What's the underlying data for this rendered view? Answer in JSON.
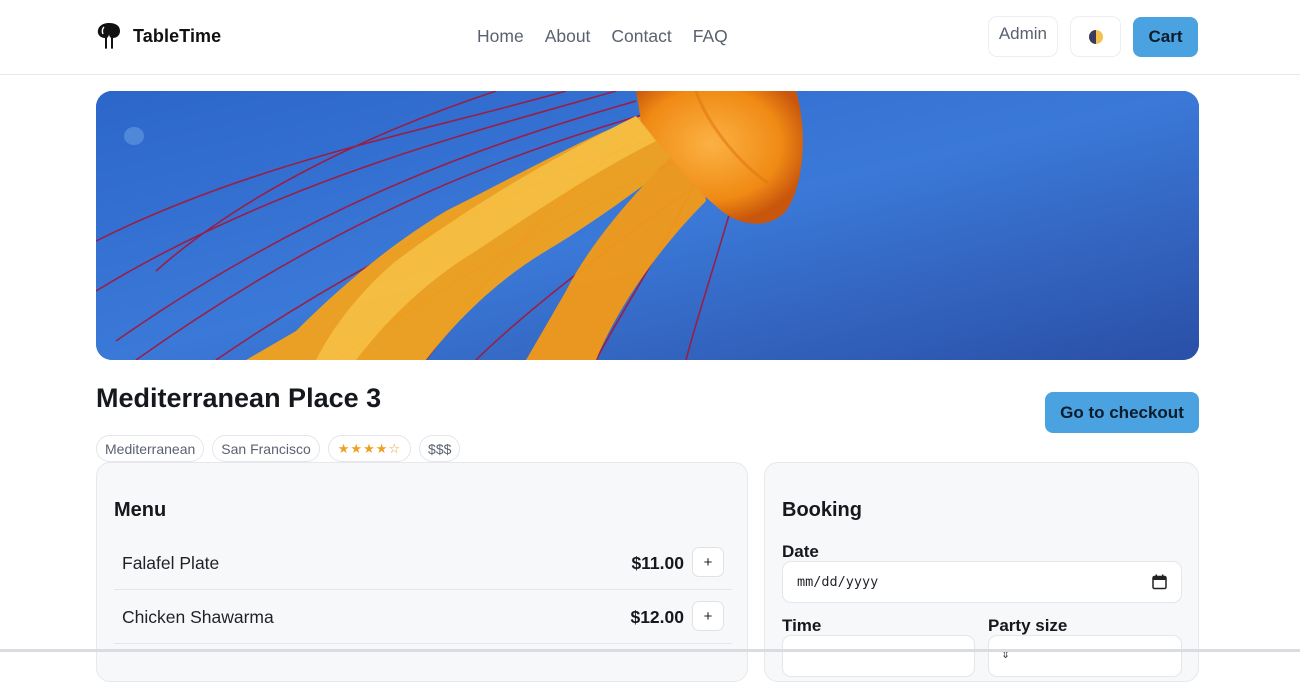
{
  "header": {
    "brand": "TableTime",
    "nav": [
      "Home",
      "About",
      "Contact",
      "FAQ"
    ],
    "admin_label": "Admin",
    "theme_icon": "half-moon-icon",
    "cart_label": "Cart"
  },
  "hero": {
    "image": "jellyfish-photo",
    "colors": {
      "water": "#2f66cc",
      "jelly": "#f59a1a",
      "tentacles": "#b0203a"
    }
  },
  "restaurant": {
    "name": "Mediterranean Place 3",
    "checkout_label": "Go to checkout",
    "tags": [
      "Mediterranean",
      "San Francisco",
      "$$$"
    ],
    "rating": {
      "stars": 4.5,
      "max": 5,
      "display": "★★★★☆"
    }
  },
  "menu": {
    "title": "Menu",
    "items": [
      {
        "name": "Falafel Plate",
        "price": "$11.00",
        "add_label": "+"
      },
      {
        "name": "Chicken Shawarma",
        "price": "$12.00",
        "add_label": "+"
      }
    ]
  },
  "booking": {
    "title": "Booking",
    "date_label": "Date",
    "date_value": "mm/dd/yyyy",
    "time_label": "Time",
    "party_label": "Party size"
  },
  "colors": {
    "accent": "#4aa3e0",
    "star": "#f0a020",
    "panel_bg": "#f7f8fa"
  }
}
